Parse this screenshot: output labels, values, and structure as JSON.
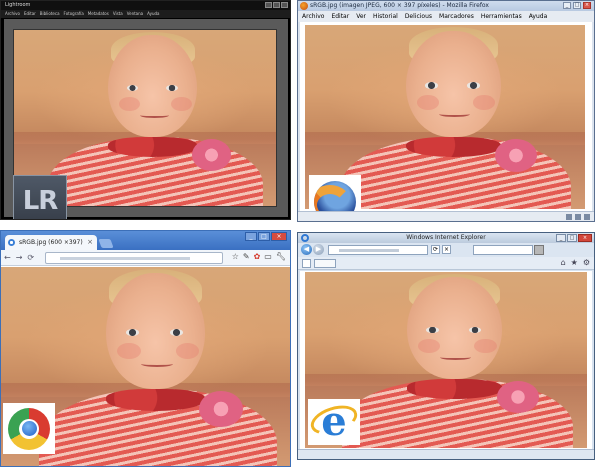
{
  "lightroom": {
    "title": "Lightroom",
    "menu": [
      "Archivo",
      "Editar",
      "Biblioteca",
      "Fotografía",
      "Metadatos",
      "Vista",
      "Ventana",
      "Ayuda"
    ],
    "logo_text": "LR"
  },
  "firefox": {
    "title": "sRGB.jpg (imagen JPEG, 600 × 397 píxeles) - Mozilla Firefox",
    "menu": [
      "Archivo",
      "Editar",
      "Ver",
      "Historial",
      "Delicious",
      "Marcadores",
      "Herramientas",
      "Ayuda"
    ]
  },
  "chrome": {
    "tab_title": "sRGB.jpg (600 ×397)"
  },
  "ie": {
    "title": "Windows Internet Explorer"
  },
  "colors": {
    "lightroom_chrome": "#000000",
    "lightroom_stage": "#5a5a5a",
    "firefox_frame": "#dbe3ee",
    "chrome_frame": "#3a70c2",
    "ie_frame": "#d7e2ef"
  },
  "icons": {
    "firefox_logo": "firefox-logo-icon",
    "chrome_logo": "chrome-logo-icon",
    "ie_logo": "internet-explorer-logo-icon",
    "lightroom_logo": "lightroom-logo-icon"
  }
}
